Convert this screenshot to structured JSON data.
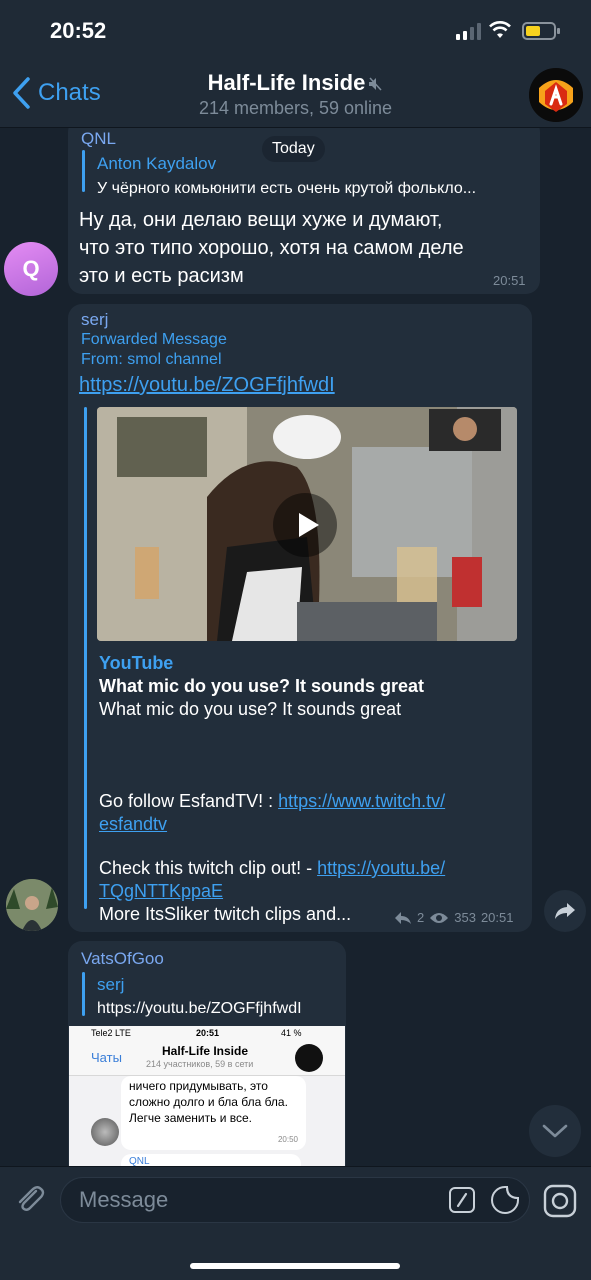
{
  "status_bar": {
    "time": "20:52"
  },
  "nav": {
    "back_label": "Chats",
    "title": "Half-Life Inside",
    "subtitle": "214 members, 59 online"
  },
  "date_pill": "Today",
  "messages": [
    {
      "sender": "QNL",
      "avatar_letter": "Q",
      "reply_name": "Anton Kaydalov",
      "reply_text": "У чёрного комьюнити есть очень крутой фолькло...",
      "text_lines": [
        "Ну да, они делаю вещи хуже и думают,",
        "что это типо хорошо, хотя на самом деле",
        "это и есть расизм"
      ],
      "time": "20:51"
    },
    {
      "sender": "serj",
      "forward_label": "Forwarded Message",
      "forward_from": "From: smol channel",
      "link": "https://youtu.be/ZOGFfjhfwdI",
      "preview": {
        "site": "YouTube",
        "heading": "What mic do you use? It sounds great",
        "desc": "What mic do you use? It sounds great",
        "follow_text": "Go follow  EsfandTV! : ",
        "follow_link_1": "https://www.twitch.tv/",
        "follow_link_2": "esfandtv",
        "clip_text": "Check this twitch clip out! - ",
        "clip_link_1": "https://youtu.be/",
        "clip_link_2": "TQgNTTKppaE",
        "more_text": "More ItsSliker twitch clips and..."
      },
      "replies_count": "2",
      "views": "353",
      "time": "20:51"
    },
    {
      "sender": "VatsOfGoo",
      "reply_name": "serj",
      "reply_text": "https://youtu.be/ZOGFfjhfwdI",
      "embedded_screenshot": {
        "carrier": "Tele2  LTE",
        "time": "20:51",
        "battery": "41 %",
        "back_label": "Чаты",
        "title": "Half-Life Inside",
        "subtitle": "214 участников, 59 в сети",
        "bubble_text": "ничего придумывать, это сложно долго и бла бла бла. Легче заменить и все.",
        "bubble_time": "20:50",
        "next_sender": "QNL"
      }
    }
  ],
  "input": {
    "placeholder": "Message"
  },
  "colors": {
    "accent": "#3ea0f0",
    "bubble": "#222e3b",
    "background": "#18222d",
    "bar": "#1f2a36"
  }
}
